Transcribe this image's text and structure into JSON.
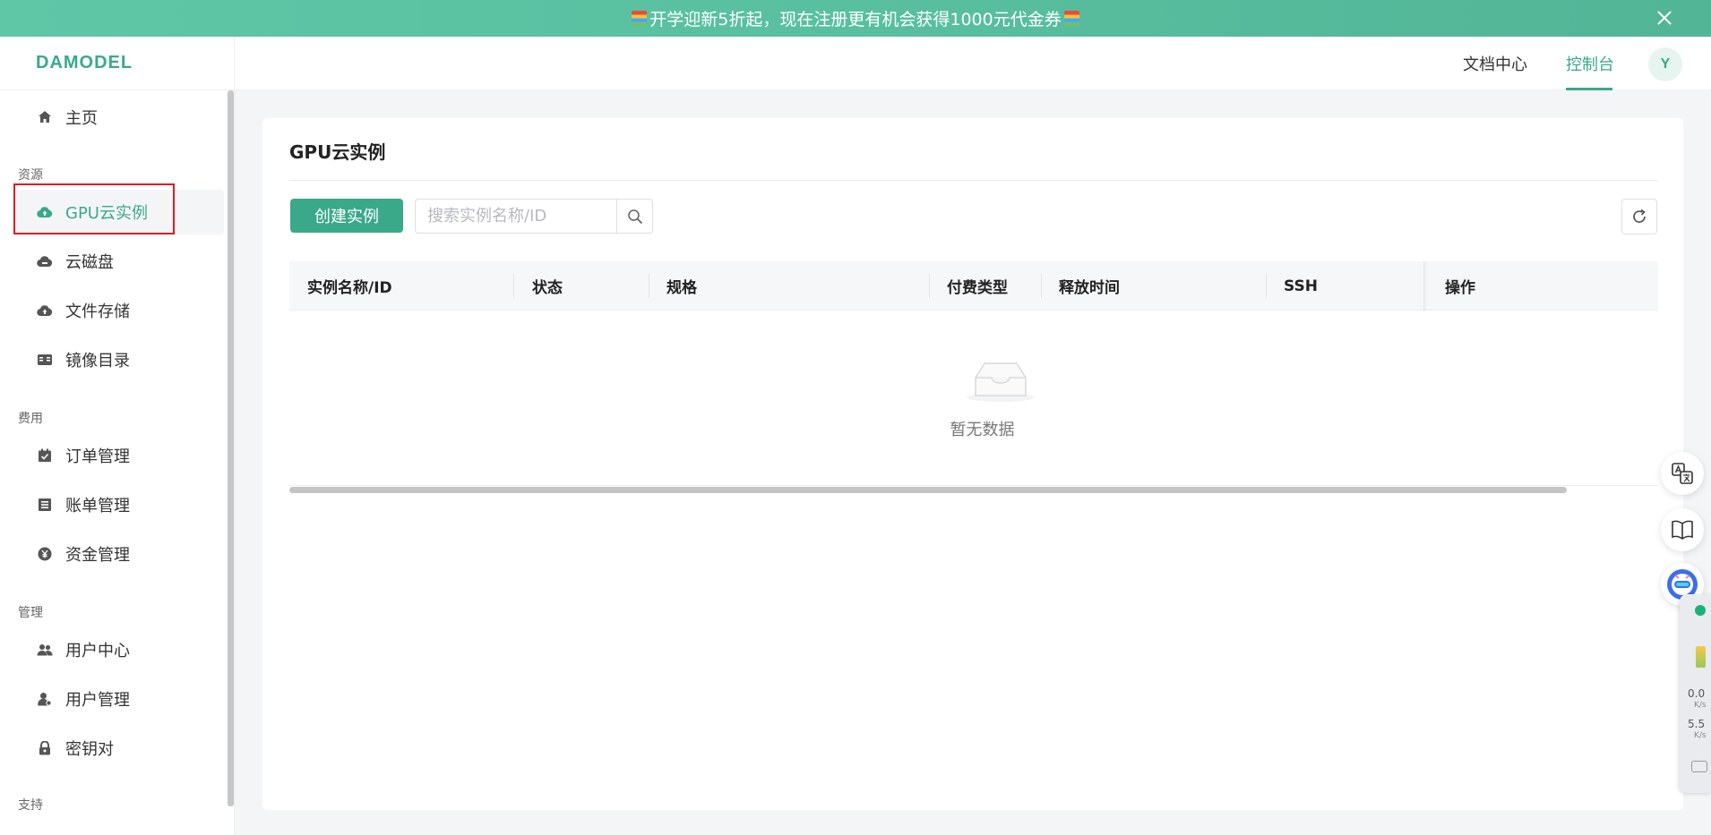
{
  "banner": {
    "text": "开学迎新5折起，现在注册更有机会获得1000元代金券"
  },
  "header": {
    "logo": "DAMODEL",
    "nav": {
      "docs": "文档中心",
      "console": "控制台"
    },
    "avatar_letter": "Y"
  },
  "sidebar": {
    "home": "主页",
    "groups": {
      "resources": "资源",
      "billing": "费用",
      "manage": "管理",
      "support": "支持"
    },
    "items": {
      "gpu": "GPU云实例",
      "disk": "云磁盘",
      "file_storage": "文件存储",
      "images": "镜像目录",
      "orders": "订单管理",
      "bills": "账单管理",
      "funds": "资金管理",
      "user_center": "用户中心",
      "user_manage": "用户管理",
      "keypair": "密钥对"
    },
    "active": "gpu"
  },
  "main": {
    "title": "GPU云实例",
    "create_button": "创建实例",
    "search_placeholder": "搜索实例名称/ID",
    "columns": [
      "实例名称/ID",
      "状态",
      "规格",
      "付费类型",
      "释放时间",
      "SSH",
      "操作"
    ],
    "empty_text": "暂无数据"
  },
  "monitor": {
    "upload": "0.0",
    "download": "5.5",
    "unit": "K/s"
  },
  "colors": {
    "accent": "#3aa98a",
    "banner": "#5fc7a6",
    "highlight_box": "#e01b24"
  }
}
